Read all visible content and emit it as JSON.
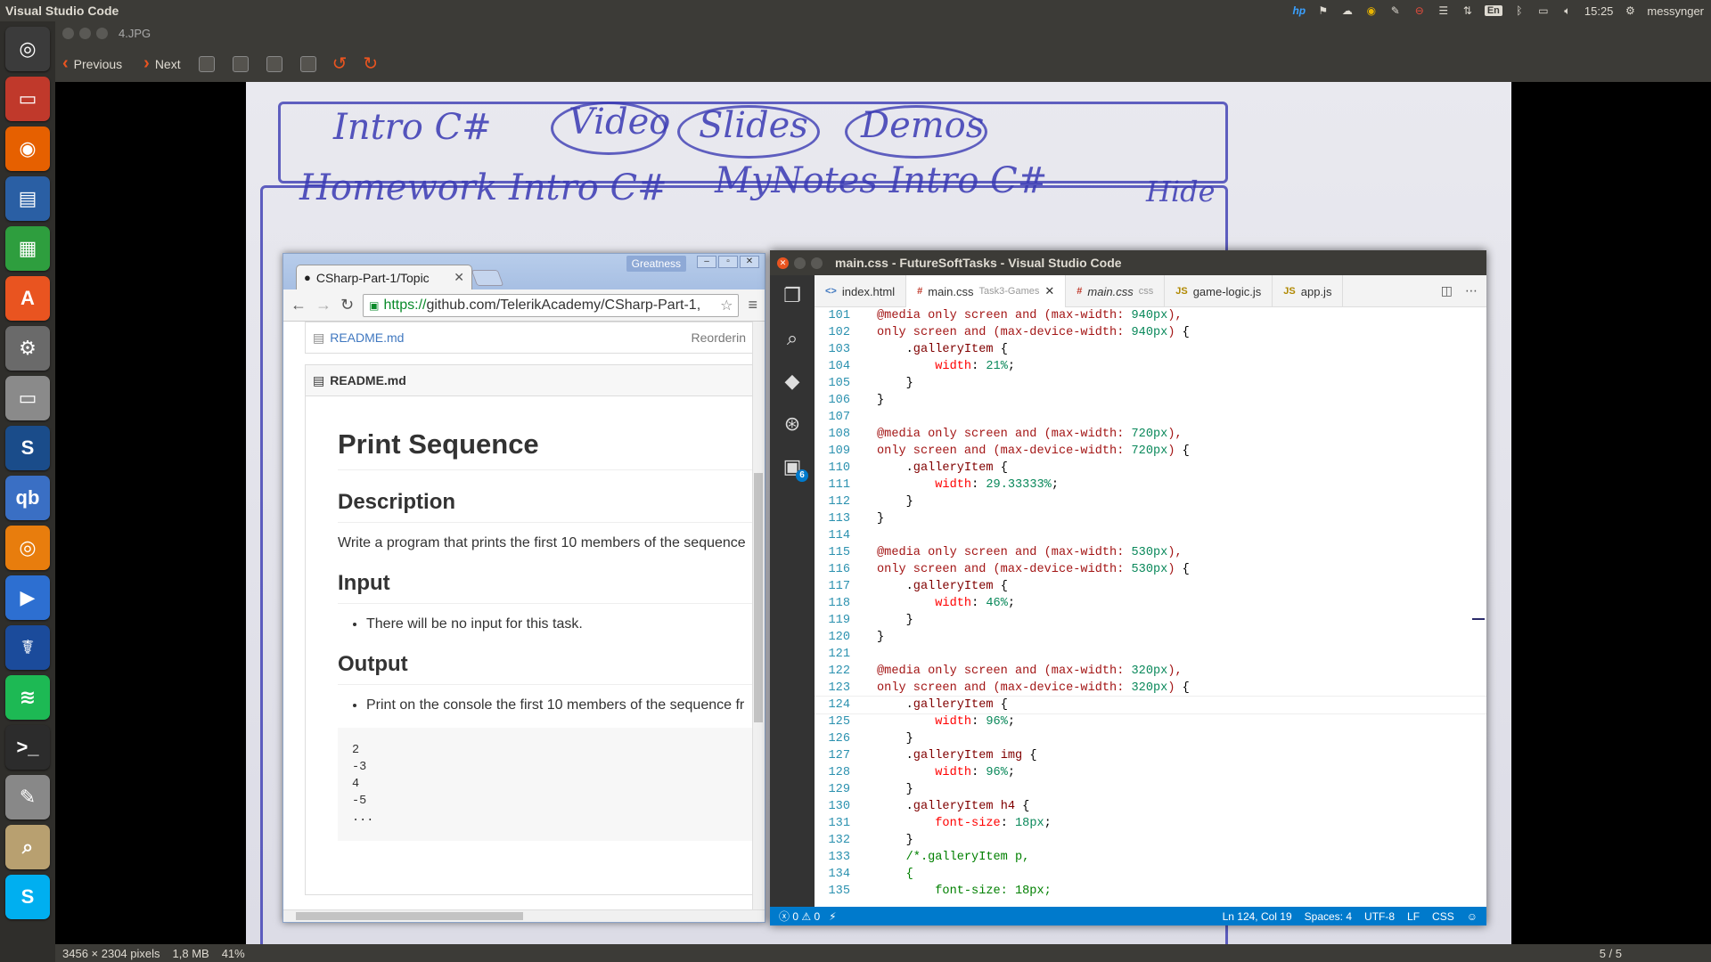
{
  "top_panel": {
    "app_name": "Visual Studio Code",
    "time": "15:25",
    "user": "messynger",
    "keyboard": "En"
  },
  "launcher": {
    "items": [
      {
        "name": "dash",
        "color": "#3b3b3b",
        "glyph": "◎"
      },
      {
        "name": "files",
        "color": "#c0392b",
        "glyph": "▭"
      },
      {
        "name": "firefox",
        "color": "#e66000",
        "glyph": "◉"
      },
      {
        "name": "libreoffice-writer",
        "color": "#2a5fa4",
        "glyph": "▤"
      },
      {
        "name": "libreoffice-calc",
        "color": "#2e9e3e",
        "glyph": "▦"
      },
      {
        "name": "software-center",
        "color": "#e95420",
        "glyph": "A"
      },
      {
        "name": "system-settings",
        "color": "#6a6a6a",
        "glyph": "⚙"
      },
      {
        "name": "files-2",
        "color": "#8a8a8a",
        "glyph": "▭"
      },
      {
        "name": "app-s",
        "color": "#1a4c8a",
        "glyph": "S"
      },
      {
        "name": "qbittorrent",
        "color": "#3a6fc4",
        "glyph": "qb"
      },
      {
        "name": "blender",
        "color": "#e87d0d",
        "glyph": "◎"
      },
      {
        "name": "media-player",
        "color": "#2d6fd1",
        "glyph": "▶"
      },
      {
        "name": "app-caduceus",
        "color": "#1b4b9b",
        "glyph": "☤"
      },
      {
        "name": "spotify",
        "color": "#1db954",
        "glyph": "≋"
      },
      {
        "name": "terminal",
        "color": "#2c2c2c",
        "glyph": ">_"
      },
      {
        "name": "text-editor",
        "color": "#888",
        "glyph": "✎"
      },
      {
        "name": "image-viewer",
        "color": "#b8a070",
        "glyph": "⌕"
      },
      {
        "name": "skype",
        "color": "#00aff0",
        "glyph": "S"
      }
    ]
  },
  "viewer": {
    "filename": "4.JPG",
    "previous_label": "Previous",
    "next_label": "Next",
    "status_dims": "3456 × 2304 pixels",
    "status_size": "1,8 MB",
    "status_zoom": "41%",
    "pager": "5 / 5",
    "sketch": {
      "title": "Intro C#",
      "btn1": "Video",
      "btn2": "Slides",
      "btn3": "Demos",
      "left": "Homework Intro C#",
      "right": "MyNotes Intro C#",
      "corner": "Hide"
    }
  },
  "chrome": {
    "tab_title": "CSharp-Part-1/Topic",
    "profile": "Greatness",
    "url_https": "https://",
    "url_rest": "github.com/TelerikAcademy/CSharp-Part-1,",
    "file_link": "README.md",
    "file_msg": "Reorderin",
    "readme_head": "README.md",
    "h1": "Print Sequence",
    "h_desc": "Description",
    "desc": "Write a program that prints the first 10 members of the sequence",
    "h_input": "Input",
    "input_item": "There will be no input for this task.",
    "h_output": "Output",
    "output_item": "Print on the console the first 10 members of the sequence fr",
    "pre": "2\n-3\n4\n-5\n..."
  },
  "vscode": {
    "title": "main.css - FutureSoftTasks - Visual Studio Code",
    "tabs": [
      {
        "label": "index.html",
        "icon": "<>",
        "dim": "",
        "active": false,
        "italic": false
      },
      {
        "label": "main.css",
        "icon": "#",
        "dim": "Task3-Games",
        "active": true,
        "italic": false
      },
      {
        "label": "main.css",
        "icon": "#",
        "dim": "css",
        "active": false,
        "italic": true
      },
      {
        "label": "game-logic.js",
        "icon": "JS",
        "dim": "",
        "active": false,
        "italic": false
      },
      {
        "label": "app.js",
        "icon": "JS",
        "dim": "",
        "active": false,
        "italic": false
      }
    ],
    "activity_badge": "6",
    "status": {
      "errors": "0",
      "warnings": "0",
      "position": "Ln 124, Col 19",
      "spaces": "Spaces: 4",
      "encoding": "UTF-8",
      "eol": "LF",
      "language": "CSS"
    },
    "lines": [
      {
        "n": "101",
        "t": [
          [
            "t-kw",
            "@media only screen and (max-width: "
          ],
          [
            "t-num",
            "940px"
          ],
          [
            "t-kw",
            "),"
          ]
        ]
      },
      {
        "n": "102",
        "t": [
          [
            "t-kw",
            "only screen and (max-device-width: "
          ],
          [
            "t-num",
            "940px"
          ],
          [
            "t-kw",
            ") "
          ],
          [
            "t-pl",
            "{"
          ]
        ]
      },
      {
        "n": "103",
        "t": [
          [
            "t-pl",
            "    ."
          ],
          [
            "t-sel",
            "galleryItem"
          ],
          [
            "t-pl",
            " {"
          ]
        ]
      },
      {
        "n": "104",
        "t": [
          [
            "t-prop",
            "        width"
          ],
          [
            "t-pl",
            ": "
          ],
          [
            "t-num",
            "21%"
          ],
          [
            "t-pl",
            ";"
          ]
        ]
      },
      {
        "n": "105",
        "t": [
          [
            "t-pl",
            "    }"
          ]
        ]
      },
      {
        "n": "106",
        "t": [
          [
            "t-pl",
            "}"
          ]
        ]
      },
      {
        "n": "107",
        "t": []
      },
      {
        "n": "108",
        "t": [
          [
            "t-kw",
            "@media only screen and (max-width: "
          ],
          [
            "t-num",
            "720px"
          ],
          [
            "t-kw",
            "),"
          ]
        ]
      },
      {
        "n": "109",
        "t": [
          [
            "t-kw",
            "only screen and (max-device-width: "
          ],
          [
            "t-num",
            "720px"
          ],
          [
            "t-kw",
            ") "
          ],
          [
            "t-pl",
            "{"
          ]
        ]
      },
      {
        "n": "110",
        "t": [
          [
            "t-pl",
            "    ."
          ],
          [
            "t-sel",
            "galleryItem"
          ],
          [
            "t-pl",
            " {"
          ]
        ]
      },
      {
        "n": "111",
        "t": [
          [
            "t-prop",
            "        width"
          ],
          [
            "t-pl",
            ": "
          ],
          [
            "t-num",
            "29.33333%"
          ],
          [
            "t-pl",
            ";"
          ]
        ]
      },
      {
        "n": "112",
        "t": [
          [
            "t-pl",
            "    }"
          ]
        ]
      },
      {
        "n": "113",
        "t": [
          [
            "t-pl",
            "}"
          ]
        ]
      },
      {
        "n": "114",
        "t": []
      },
      {
        "n": "115",
        "t": [
          [
            "t-kw",
            "@media only screen and (max-width: "
          ],
          [
            "t-num",
            "530px"
          ],
          [
            "t-kw",
            "),"
          ]
        ]
      },
      {
        "n": "116",
        "t": [
          [
            "t-kw",
            "only screen and (max-device-width: "
          ],
          [
            "t-num",
            "530px"
          ],
          [
            "t-kw",
            ") "
          ],
          [
            "t-pl",
            "{"
          ]
        ]
      },
      {
        "n": "117",
        "t": [
          [
            "t-pl",
            "    ."
          ],
          [
            "t-sel",
            "galleryItem"
          ],
          [
            "t-pl",
            " {"
          ]
        ]
      },
      {
        "n": "118",
        "t": [
          [
            "t-prop",
            "        width"
          ],
          [
            "t-pl",
            ": "
          ],
          [
            "t-num",
            "46%"
          ],
          [
            "t-pl",
            ";"
          ]
        ]
      },
      {
        "n": "119",
        "t": [
          [
            "t-pl",
            "    }"
          ]
        ]
      },
      {
        "n": "120",
        "t": [
          [
            "t-pl",
            "}"
          ]
        ]
      },
      {
        "n": "121",
        "t": []
      },
      {
        "n": "122",
        "t": [
          [
            "t-kw",
            "@media only screen and (max-width: "
          ],
          [
            "t-num",
            "320px"
          ],
          [
            "t-kw",
            "),"
          ]
        ]
      },
      {
        "n": "123",
        "t": [
          [
            "t-kw",
            "only screen and (max-device-width: "
          ],
          [
            "t-num",
            "320px"
          ],
          [
            "t-kw",
            ") "
          ],
          [
            "t-pl",
            "{"
          ]
        ]
      },
      {
        "n": "124",
        "t": [
          [
            "t-pl",
            "    ."
          ],
          [
            "t-sel",
            "galleryItem"
          ],
          [
            "t-pl",
            " {"
          ]
        ],
        "cur": true
      },
      {
        "n": "125",
        "t": [
          [
            "t-prop",
            "        width"
          ],
          [
            "t-pl",
            ": "
          ],
          [
            "t-num",
            "96%"
          ],
          [
            "t-pl",
            ";"
          ]
        ]
      },
      {
        "n": "126",
        "t": [
          [
            "t-pl",
            "    }"
          ]
        ]
      },
      {
        "n": "127",
        "t": [
          [
            "t-pl",
            "    ."
          ],
          [
            "t-sel",
            "galleryItem img"
          ],
          [
            "t-pl",
            " {"
          ]
        ]
      },
      {
        "n": "128",
        "t": [
          [
            "t-prop",
            "        width"
          ],
          [
            "t-pl",
            ": "
          ],
          [
            "t-num",
            "96%"
          ],
          [
            "t-pl",
            ";"
          ]
        ]
      },
      {
        "n": "129",
        "t": [
          [
            "t-pl",
            "    }"
          ]
        ]
      },
      {
        "n": "130",
        "t": [
          [
            "t-pl",
            "    ."
          ],
          [
            "t-sel",
            "galleryItem h4"
          ],
          [
            "t-pl",
            " {"
          ]
        ]
      },
      {
        "n": "131",
        "t": [
          [
            "t-prop",
            "        font-size"
          ],
          [
            "t-pl",
            ": "
          ],
          [
            "t-num",
            "18px"
          ],
          [
            "t-pl",
            ";"
          ]
        ]
      },
      {
        "n": "132",
        "t": [
          [
            "t-pl",
            "    }"
          ]
        ]
      },
      {
        "n": "133",
        "t": [
          [
            "t-com",
            "    /*.galleryItem p,"
          ]
        ]
      },
      {
        "n": "134",
        "t": [
          [
            "t-com",
            "    {"
          ]
        ]
      },
      {
        "n": "135",
        "t": [
          [
            "t-com",
            "        font-size: 18px;"
          ]
        ]
      }
    ]
  }
}
